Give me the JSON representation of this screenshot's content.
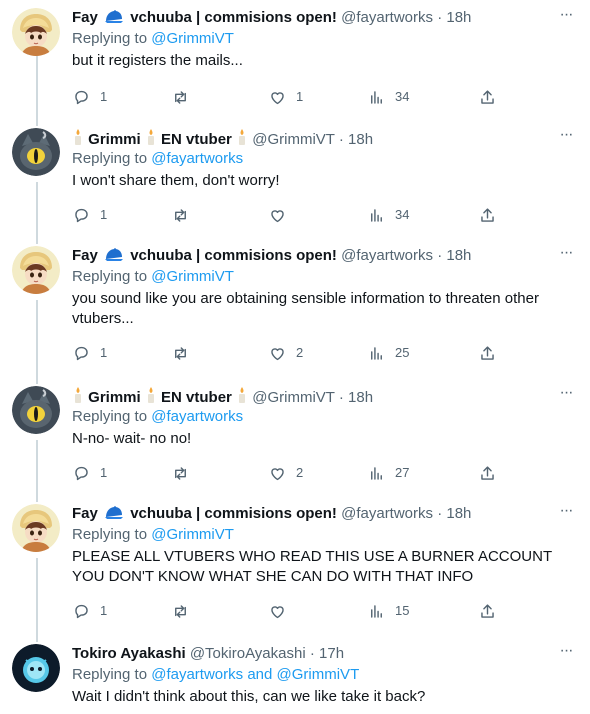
{
  "users": {
    "fay": {
      "name_prefix": "Fay",
      "name_suffix": "vchuuba | commisions open!",
      "handle": "@fayartworks"
    },
    "grimmi": {
      "name_prefix": "Grimmi",
      "name_suffix": "EN vtuber",
      "handle": "@GrimmiVT"
    },
    "tokiro": {
      "name": "Tokiro Ayakashi",
      "handle": "@TokiroAyakashi"
    }
  },
  "reply_prefix": "Replying to",
  "separator": "·",
  "tweets": [
    {
      "author": "fay",
      "time": "18h",
      "replying_to": "@GrimmiVT",
      "text": "but it registers the mails...",
      "replies": "1",
      "retweets": "",
      "likes": "1",
      "views": "34"
    },
    {
      "author": "grimmi",
      "time": "18h",
      "replying_to": "@fayartworks",
      "text": "I won't share them, don't worry!",
      "replies": "1",
      "retweets": "",
      "likes": "",
      "views": "34"
    },
    {
      "author": "fay",
      "time": "18h",
      "replying_to": "@GrimmiVT",
      "text": "you sound like you are obtaining sensible information to threaten other vtubers...",
      "replies": "1",
      "retweets": "",
      "likes": "2",
      "views": "25"
    },
    {
      "author": "grimmi",
      "time": "18h",
      "replying_to": "@fayartworks",
      "text": "N-no- wait- no no!",
      "replies": "1",
      "retweets": "",
      "likes": "2",
      "views": "27"
    },
    {
      "author": "fay",
      "time": "18h",
      "replying_to": "@GrimmiVT",
      "text": "PLEASE ALL VTUBERS WHO READ THIS USE A BURNER ACCOUNT YOU DON'T KNOW WHAT SHE CAN DO WITH THAT INFO",
      "replies": "1",
      "retweets": "",
      "likes": "",
      "views": "15"
    },
    {
      "author": "tokiro",
      "time": "17h",
      "replying_to": "@fayartworks",
      "replying_and": "and",
      "replying_to_2": "@GrimmiVT",
      "text": "Wait I didn't think about this, can we like take it back?"
    }
  ],
  "more_label": "···",
  "colors": {
    "accent": "#1d9bf0",
    "muted": "#536471",
    "thread_line": "#cfd9de",
    "text": "#0f1419"
  },
  "icons": {
    "reply": "speech-bubble-icon",
    "retweet": "retweet-icon",
    "like": "heart-icon",
    "views": "bar-chart-icon",
    "share": "share-icon",
    "more": "more-dots-icon",
    "fay_emoji": "blue-cap-icon",
    "grimmi_emoji": "candle-icon"
  }
}
